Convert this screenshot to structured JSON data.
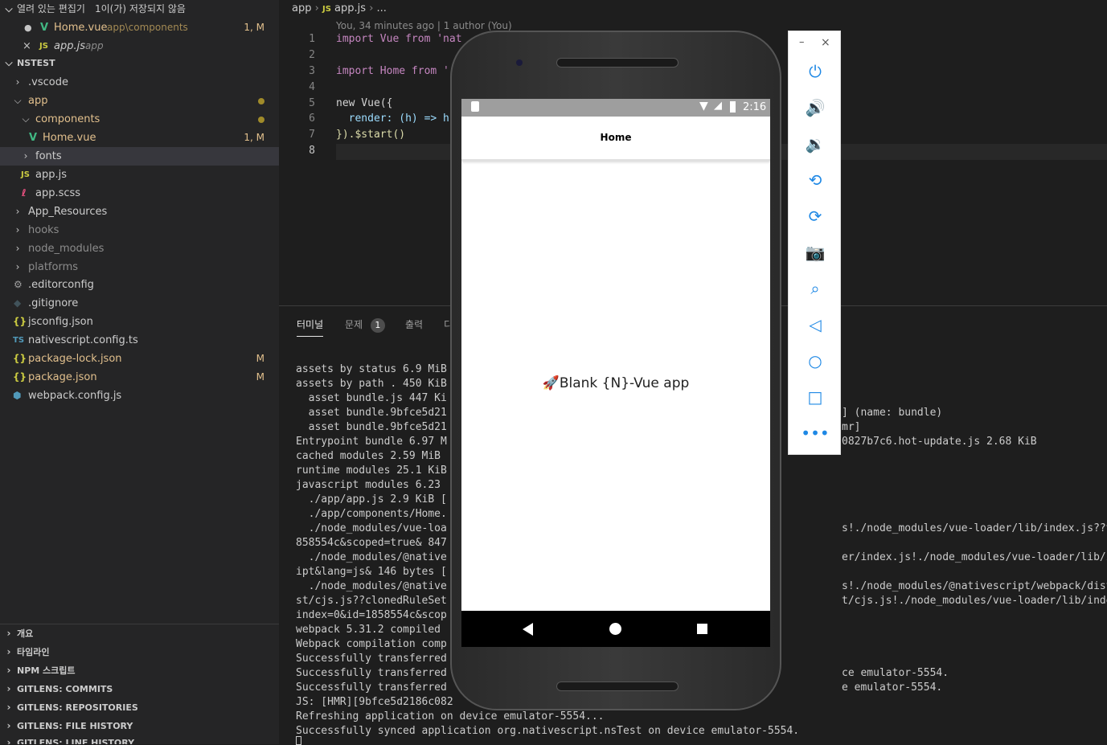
{
  "sidebar": {
    "open_editors_header": "열려 있는 편집기",
    "unsaved_note": "1이(가) 저장되지 않음",
    "open_editors": [
      {
        "name": "Home.vue",
        "path": "app\\components",
        "badge": "1, M"
      },
      {
        "name": "app.js",
        "path": "app"
      }
    ],
    "project_header": "NSTEST",
    "tree": [
      {
        "name": ".vscode"
      },
      {
        "name": "app"
      },
      {
        "name": "components"
      },
      {
        "name": "Home.vue",
        "badge": "1, M"
      },
      {
        "name": "fonts"
      },
      {
        "name": "app.js"
      },
      {
        "name": "app.scss"
      },
      {
        "name": "App_Resources"
      },
      {
        "name": "hooks"
      },
      {
        "name": "node_modules"
      },
      {
        "name": "platforms"
      },
      {
        "name": ".editorconfig"
      },
      {
        "name": ".gitignore"
      },
      {
        "name": "jsconfig.json"
      },
      {
        "name": "nativescript.config.ts"
      },
      {
        "name": "package-lock.json",
        "badge": "M"
      },
      {
        "name": "package.json",
        "badge": "M"
      },
      {
        "name": "webpack.config.js"
      }
    ],
    "bottom_sections": [
      "개요",
      "타임라인",
      "NPM 스크립트",
      "GITLENS: COMMITS",
      "GITLENS: REPOSITORIES",
      "GITLENS: FILE HISTORY",
      "GITLENS: LINE HISTORY"
    ]
  },
  "editor": {
    "breadcrumb": {
      "folder": "app",
      "file": "app.js",
      "more": "..."
    },
    "blame": "You, 34 minutes ago | 1 author (You)",
    "lines": [
      "import Vue from 'nat",
      "",
      "import Home from '",
      "",
      "new Vue({",
      "  render: (h) => h",
      "}).$start()",
      ""
    ],
    "line_numbers": [
      "1",
      "2",
      "3",
      "4",
      "5",
      "6",
      "7",
      "8"
    ]
  },
  "panel": {
    "tabs": [
      "터미널",
      "문제",
      "출력",
      "디"
    ],
    "problems_count": "1",
    "terminal_left": [
      "assets by status 6.9 MiB",
      "assets by path . 450 KiB",
      "  asset bundle.js 447 Ki",
      "  asset bundle.9bfce5d21",
      "  asset bundle.9bfce5d21",
      "Entrypoint bundle 6.97 M",
      "cached modules 2.59 MiB",
      "runtime modules 25.1 KiB",
      "javascript modules 6.23",
      "  ./app/app.js 2.9 KiB [",
      "  ./app/components/Home.",
      "  ./node_modules/vue-loa",
      "858554c&scoped=true& 847",
      "  ./node_modules/@native",
      "ipt&lang=js& 146 bytes [",
      "  ./node_modules/@native",
      "st/cjs.js??clonedRuleSet",
      "index=0&id=1858554c&scop",
      "webpack 5.31.2 compiled ",
      "Webpack compilation comp",
      "Successfully transferred",
      "Successfully transferred",
      "Successfully transferred",
      "JS: [HMR][9bfce5d2186c082",
      "Refreshing application on device emulator-5554...",
      "Successfully synced application org.nativescript.nsTest on device emulator-5554."
    ],
    "terminal_right": [
      {
        "text": "] (name: bundle)",
        "row": 3
      },
      {
        "text": "mr]",
        "row": 4
      },
      {
        "text": "0827b7c6.hot-update.js 2.68 KiB",
        "row": 5
      },
      {
        "text": "s!./node_modules/vue-loader/lib/index.js??vue-load",
        "row": 11
      },
      {
        "text": "er/index.js!./node_modules/vue-loader/lib/index.js",
        "row": 13
      },
      {
        "text": "s!./node_modules/@nativescript/webpack/dist/loader",
        "row": 15
      },
      {
        "text": "t/cjs.js!./node_modules/vue-loader/lib/index.js??v",
        "row": 16
      },
      {
        "text": "ce emulator-5554.",
        "row": 21
      },
      {
        "text": "e emulator-5554.",
        "row": 22
      }
    ]
  },
  "phone": {
    "time": "2:16",
    "action_bar_title": "Home",
    "message": "Blank {N}-Vue app"
  },
  "emulator_toolbar": {
    "minimize": "–",
    "close": "×",
    "buttons": [
      "power-icon",
      "volume-up-icon",
      "volume-down-icon",
      "rotate-left-icon",
      "rotate-right-icon",
      "camera-icon",
      "zoom-icon",
      "back-icon",
      "home-icon",
      "overview-icon",
      "more-icon"
    ]
  }
}
